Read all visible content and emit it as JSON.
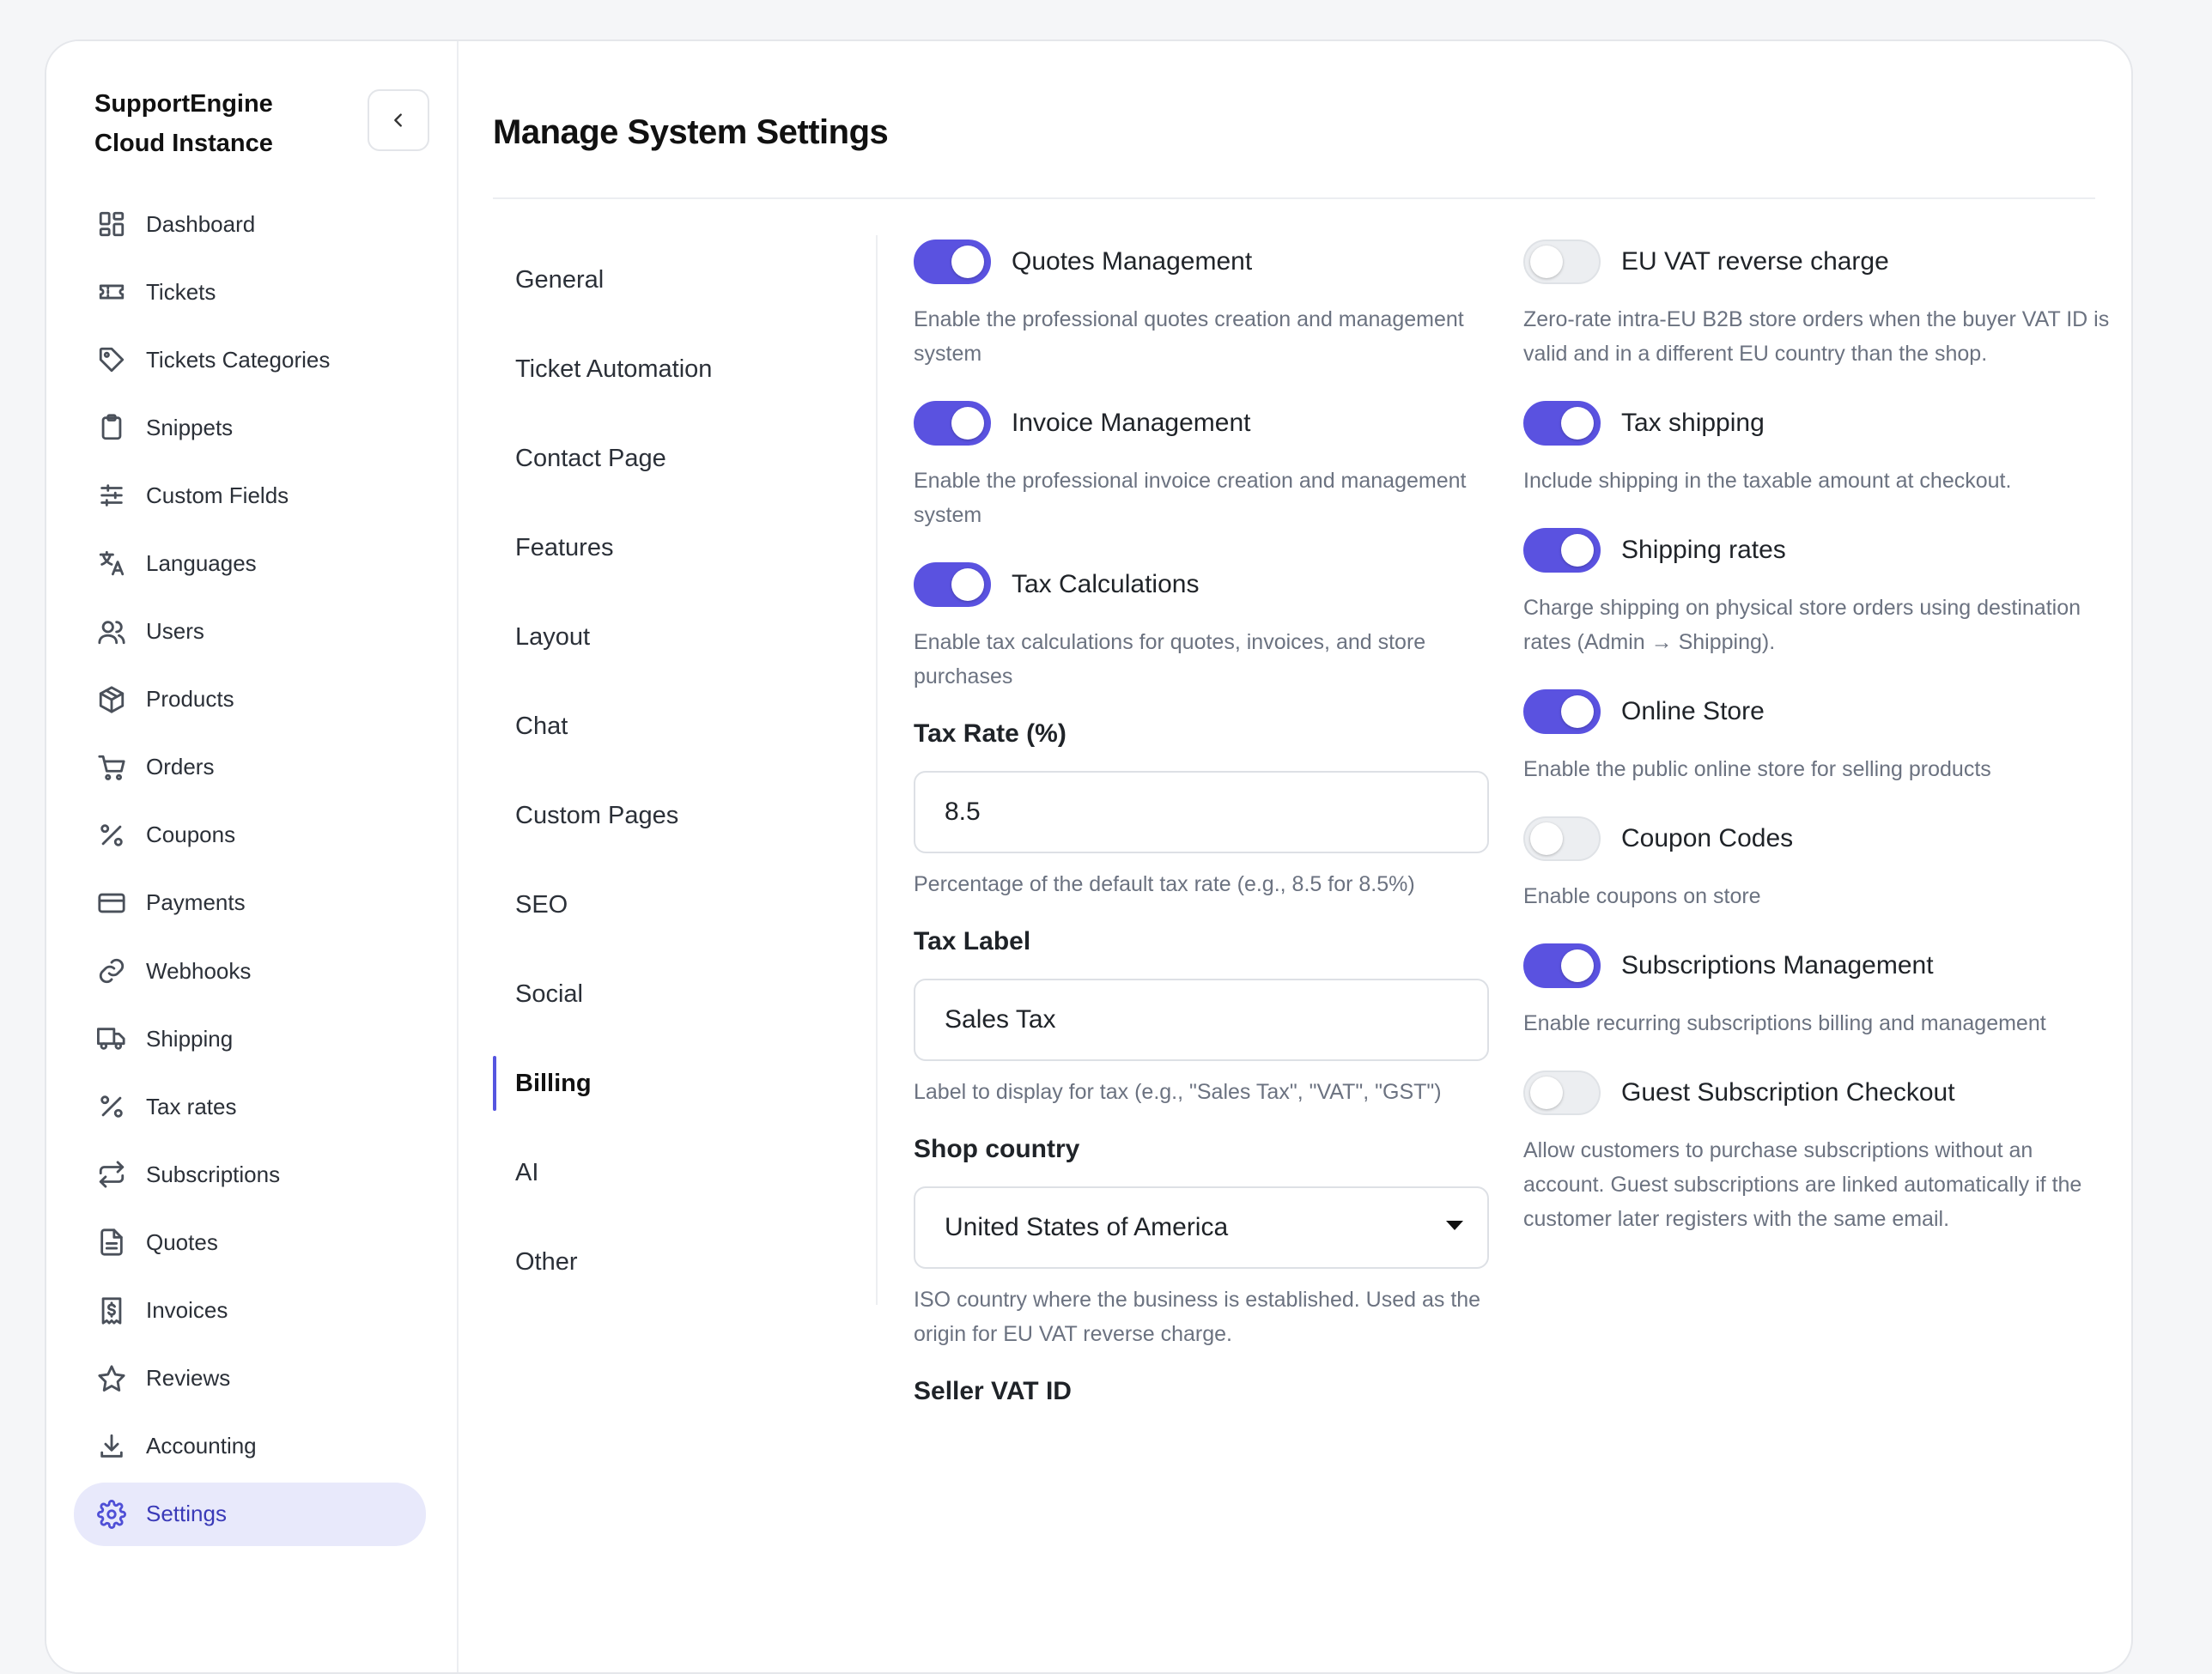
{
  "brand": {
    "line1": "SupportEngine",
    "line2": "Cloud Instance"
  },
  "sidebar": {
    "items": [
      {
        "label": "Dashboard",
        "icon": "dashboard-icon"
      },
      {
        "label": "Tickets",
        "icon": "ticket-icon"
      },
      {
        "label": "Tickets Categories",
        "icon": "tag-icon"
      },
      {
        "label": "Snippets",
        "icon": "clipboard-icon"
      },
      {
        "label": "Custom Fields",
        "icon": "sliders-icon"
      },
      {
        "label": "Languages",
        "icon": "translate-icon"
      },
      {
        "label": "Users",
        "icon": "users-icon"
      },
      {
        "label": "Products",
        "icon": "box-icon"
      },
      {
        "label": "Orders",
        "icon": "cart-icon"
      },
      {
        "label": "Coupons",
        "icon": "percent-icon"
      },
      {
        "label": "Payments",
        "icon": "credit-card-icon"
      },
      {
        "label": "Webhooks",
        "icon": "link-icon"
      },
      {
        "label": "Shipping",
        "icon": "truck-icon"
      },
      {
        "label": "Tax rates",
        "icon": "percent-icon"
      },
      {
        "label": "Subscriptions",
        "icon": "repeat-icon"
      },
      {
        "label": "Quotes",
        "icon": "document-icon"
      },
      {
        "label": "Invoices",
        "icon": "invoice-dollar-icon"
      },
      {
        "label": "Reviews",
        "icon": "star-icon"
      },
      {
        "label": "Accounting",
        "icon": "download-icon"
      },
      {
        "label": "Settings",
        "icon": "gear-icon",
        "active": true
      }
    ]
  },
  "page": {
    "title": "Manage System Settings"
  },
  "subnav": {
    "items": [
      "General",
      "Ticket Automation",
      "Contact Page",
      "Features",
      "Layout",
      "Chat",
      "Custom Pages",
      "SEO",
      "Social",
      "Billing",
      "AI",
      "Other"
    ],
    "active": "Billing"
  },
  "left": {
    "quotes": {
      "label": "Quotes Management",
      "on": true,
      "help": "Enable the professional quotes creation and management system"
    },
    "invoice": {
      "label": "Invoice Management",
      "on": true,
      "help": "Enable the professional invoice creation and management system"
    },
    "tax_calc": {
      "label": "Tax Calculations",
      "on": true,
      "help": "Enable tax calculations for quotes, invoices, and store purchases"
    },
    "tax_rate": {
      "label": "Tax Rate (%)",
      "value": "8.5",
      "help": "Percentage of the default tax rate (e.g., 8.5 for 8.5%)"
    },
    "tax_label": {
      "label": "Tax Label",
      "value": "Sales Tax",
      "help": "Label to display for tax (e.g., \"Sales Tax\", \"VAT\", \"GST\")"
    },
    "shop_country": {
      "label": "Shop country",
      "value": "United States of America",
      "help": "ISO country where the business is established. Used as the origin for EU VAT reverse charge."
    },
    "seller_vat": {
      "label": "Seller VAT ID"
    }
  },
  "right": {
    "eu_vat": {
      "label": "EU VAT reverse charge",
      "on": false,
      "help": "Zero-rate intra-EU B2B store orders when the buyer VAT ID is valid and in a different EU country than the shop."
    },
    "tax_shipping": {
      "label": "Tax shipping",
      "on": true,
      "help": "Include shipping in the taxable amount at checkout."
    },
    "shipping_rates": {
      "label": "Shipping rates",
      "on": true,
      "help": "Charge shipping on physical store orders using destination rates (Admin → Shipping)."
    },
    "online_store": {
      "label": "Online Store",
      "on": true,
      "help": "Enable the public online store for selling products"
    },
    "coupon_codes": {
      "label": "Coupon Codes",
      "on": false,
      "help": "Enable coupons on store"
    },
    "subscriptions": {
      "label": "Subscriptions Management",
      "on": true,
      "help": "Enable recurring subscriptions billing and management"
    },
    "guest_checkout": {
      "label": "Guest Subscription Checkout",
      "on": false,
      "help": "Allow customers to purchase subscriptions without an account. Guest subscriptions are linked automatically if the customer later registers with the same email."
    }
  },
  "colors": {
    "accent": "#5a52e0",
    "active_bg": "#e8e9fb"
  }
}
